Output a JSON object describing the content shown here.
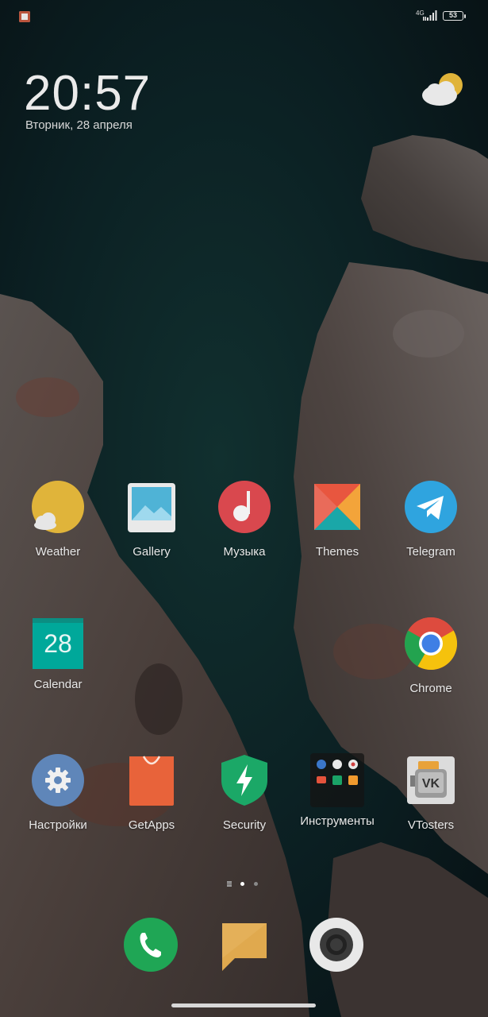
{
  "status_bar": {
    "network": "4G",
    "battery_level": "53"
  },
  "clock_widget": {
    "time": "20:57",
    "date": "Вторник, 28 апреля"
  },
  "apps": {
    "weather": "Weather",
    "gallery": "Gallery",
    "music": "Музыка",
    "themes": "Themes",
    "telegram": "Telegram",
    "calendar": "Calendar",
    "calendar_day": "28",
    "chrome": "Chrome",
    "settings": "Настройки",
    "getapps": "GetApps",
    "security": "Security",
    "tools": "Инструменты",
    "vtosters": "VTosters"
  },
  "page_indicator": {
    "pages": 2,
    "current": 1
  },
  "dock": [
    "phone-icon",
    "messages-icon",
    "camera-icon"
  ],
  "colors": {
    "weather_sun": "#e0b43a",
    "music_red": "#d9484e",
    "telegram_blue": "#2fa4df",
    "calendar_teal": "#00a89a",
    "settings_blue": "#5f86b9",
    "getapps_orange": "#e8633a",
    "security_green": "#1ba867",
    "phone_green": "#1fa655",
    "messages_amber": "#e0a94e"
  }
}
